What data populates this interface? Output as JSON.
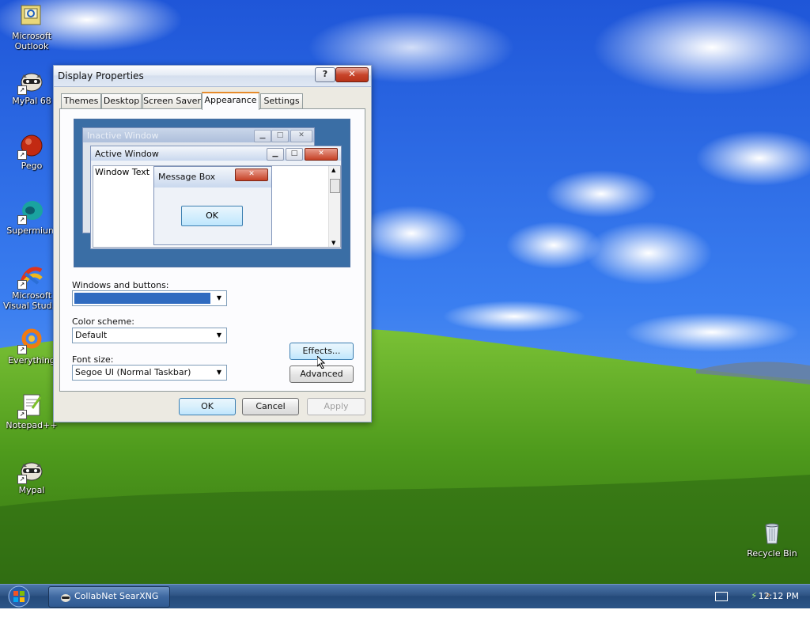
{
  "desktop": {
    "icons": [
      {
        "label": "Microsoft Outlook",
        "icon": "outlook-icon"
      },
      {
        "label": "MyPal 68",
        "icon": "mypal-raccoon-icon"
      },
      {
        "label": "Pego",
        "icon": "pego-red-ball-icon"
      },
      {
        "label": "Supermium",
        "icon": "supermium-icon"
      },
      {
        "label": "Microsoft Visual Stud...",
        "icon": "visual-studio-icon"
      },
      {
        "label": "Everything",
        "icon": "everything-search-icon"
      },
      {
        "label": "Notepad++",
        "icon": "notepadpp-icon"
      },
      {
        "label": "Mypal",
        "icon": "mypal-raccoon-icon"
      },
      {
        "label": "Recycle Bin",
        "icon": "recycle-bin-icon"
      }
    ]
  },
  "dialog": {
    "title": "Display Properties",
    "help_label": "?",
    "close_label": "✕",
    "tabs": [
      "Themes",
      "Desktop",
      "Screen Saver",
      "Appearance",
      "Settings"
    ],
    "active_tab": "Appearance",
    "preview": {
      "inactive_title": "Inactive Window",
      "active_title": "Active Window",
      "window_text": "Window Text",
      "message_box_title": "Message Box",
      "message_box_ok": "OK"
    },
    "windows_buttons_label": "Windows and buttons:",
    "windows_buttons_value": "",
    "color_scheme_label": "Color scheme:",
    "color_scheme_value": "Default",
    "font_size_label": "Font size:",
    "font_size_value": "Segoe UI (Normal Taskbar)",
    "effects_label": "Effects...",
    "advanced_label": "Advanced",
    "ok_label": "OK",
    "cancel_label": "Cancel",
    "apply_label": "Apply"
  },
  "taskbar": {
    "task_label": "CollabNet SearXNG ...",
    "clock": "12:12 PM",
    "tray_icons": [
      "keyboard-icon",
      "network-icon",
      "search-icon"
    ]
  },
  "colors": {
    "desktop_preview": "#3a6ea5",
    "active_title": "#2b6cc4",
    "tab_highlight": "#e68b2c"
  }
}
